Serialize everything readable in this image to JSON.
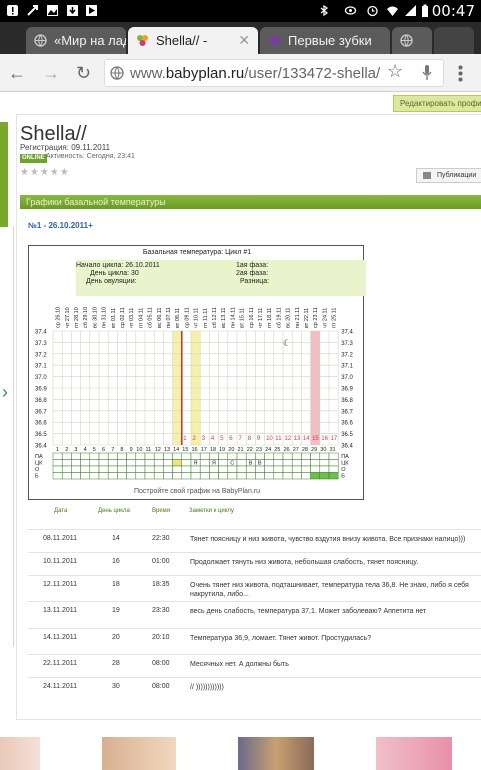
{
  "status_bar": {
    "time": "00:47",
    "icons_left": [
      "alert-icon",
      "usb-icon",
      "image-icon",
      "download-icon",
      "play-icon"
    ],
    "icons_right": [
      "wifi-icon",
      "bluetooth-icon",
      "vibrate-icon",
      "alarm-icon",
      "signal-icon",
      "battery-icon"
    ]
  },
  "tabs": [
    {
      "label": "«Мир на ладо",
      "favicon": "globe-icon",
      "active": false
    },
    {
      "label": "Shella// -",
      "favicon": "babyplan-icon",
      "active": true
    },
    {
      "label": "Первые зубки",
      "favicon": "diamond-icon",
      "active": false
    },
    {
      "label": "",
      "favicon": "globe-icon",
      "active": false
    }
  ],
  "omnibox": {
    "url_prefix": "www.",
    "url_domain": "babyplan.ru",
    "url_rest": "/user/133472-shella/"
  },
  "profile": {
    "edit_button": "Редактировать профиль",
    "name": "Shella//",
    "registration": "Регистрация: 09.11.2011",
    "online_badge": "ONLINE",
    "activity": "Активность: Сегодня, 23:41",
    "publications_button": "Публикации",
    "rating_stars": 0
  },
  "section": {
    "title": "Графики базальной температуры",
    "cycle_title": "№1 - 26.10.2011+"
  },
  "chart": {
    "title": "Базальная температура: Цикл #1",
    "cycle_start": "Начало цикла: 26.10.2011",
    "cycle_day": "День цикла: 30",
    "ovulation_day": "День овуляции:",
    "phase1": "1ая фаза:",
    "phase2": "2ая фаза:",
    "difference": "Разница:",
    "footer": "Постройте свой график на BabyPlan.ru",
    "row_labels": [
      "ПА",
      "ЦК",
      "О",
      "Б"
    ]
  },
  "chart_data": {
    "type": "line",
    "y_ticks": [
      "37.4",
      "37.3",
      "37.2",
      "37.1",
      "37.0",
      "36.9",
      "36.8",
      "36.7",
      "36.6",
      "36.5",
      "36.4"
    ],
    "ylim": [
      36.4,
      37.4
    ],
    "dates": [
      "ср 26.10",
      "чт 27.10",
      "пт 28.10",
      "сб 29.10",
      "вс 30.10",
      "пн 31.10",
      "вт 01.11",
      "ср 02.11",
      "чт 03.11",
      "пт 04.11",
      "сб 05.11",
      "вс 06.11",
      "пн 07.11",
      "вт 08.11",
      "ср 09.11",
      "чт 10.11",
      "пт 11.11",
      "сб 12.11",
      "вс 13.11",
      "пн 14.11",
      "вт 15.11",
      "ср 16.11",
      "чт 17.11",
      "пт 18.11",
      "сб 19.11",
      "вс 20.11",
      "пн 21.11",
      "вт 22.11",
      "ср 23.11",
      "чт 24.11",
      "пт 25.11"
    ],
    "day_numbers": [
      "1",
      "2",
      "3",
      "4",
      "5",
      "6",
      "7",
      "8",
      "9",
      "10",
      "11",
      "12",
      "13",
      "14",
      "15",
      "16",
      "17",
      "18",
      "19",
      "20",
      "21",
      "22",
      "23",
      "24",
      "25",
      "26",
      "27",
      "28",
      "29",
      "30",
      "31"
    ],
    "inner_numbers": [
      "1",
      "2",
      "3",
      "4",
      "5",
      "6",
      "7",
      "8",
      "9",
      "10",
      "11",
      "12",
      "13",
      "14",
      "15",
      "16",
      "17"
    ],
    "row2_marks": [
      "Я",
      "Я",
      "С",
      "В",
      "В"
    ],
    "legend": ""
  },
  "notes": {
    "headers": {
      "date": "Дата",
      "cycle_day": "День цикла",
      "time": "Время",
      "note": "Заметки к циклу"
    },
    "rows": [
      {
        "date": "08.11.2011",
        "day": "14",
        "time": "22:30",
        "note": "Тянет поясницу и низ живота, чувство вздутия внизу живота. Все признаки налицо)))"
      },
      {
        "date": "10.11.2011",
        "day": "16",
        "time": "01:00",
        "note": "Продолжает тянуть низ живота, небольшая слабость, тянет поясницу."
      },
      {
        "date": "12.11.2011",
        "day": "18",
        "time": "18:35",
        "note": "Очень тянет низ живота, подташнивает, температура тела 36,8. Не знаю, либо я себя накрутила, либо..."
      },
      {
        "date": "13.11.2011",
        "day": "19",
        "time": "23:30",
        "note": "весь день слабость, температура 37,1. Может заболеваю? Аппетита нет"
      },
      {
        "date": "14.11.2011",
        "day": "20",
        "time": "20:10",
        "note": "Температура 36,9, ломает. Тянет живот. Простудилась?"
      },
      {
        "date": "22.11.2011",
        "day": "28",
        "time": "08:00",
        "note": "Месячных нет. А должны быть"
      },
      {
        "date": "24.11.2011",
        "day": "30",
        "time": "08:00",
        "note": "// ))))))))))))"
      }
    ]
  }
}
